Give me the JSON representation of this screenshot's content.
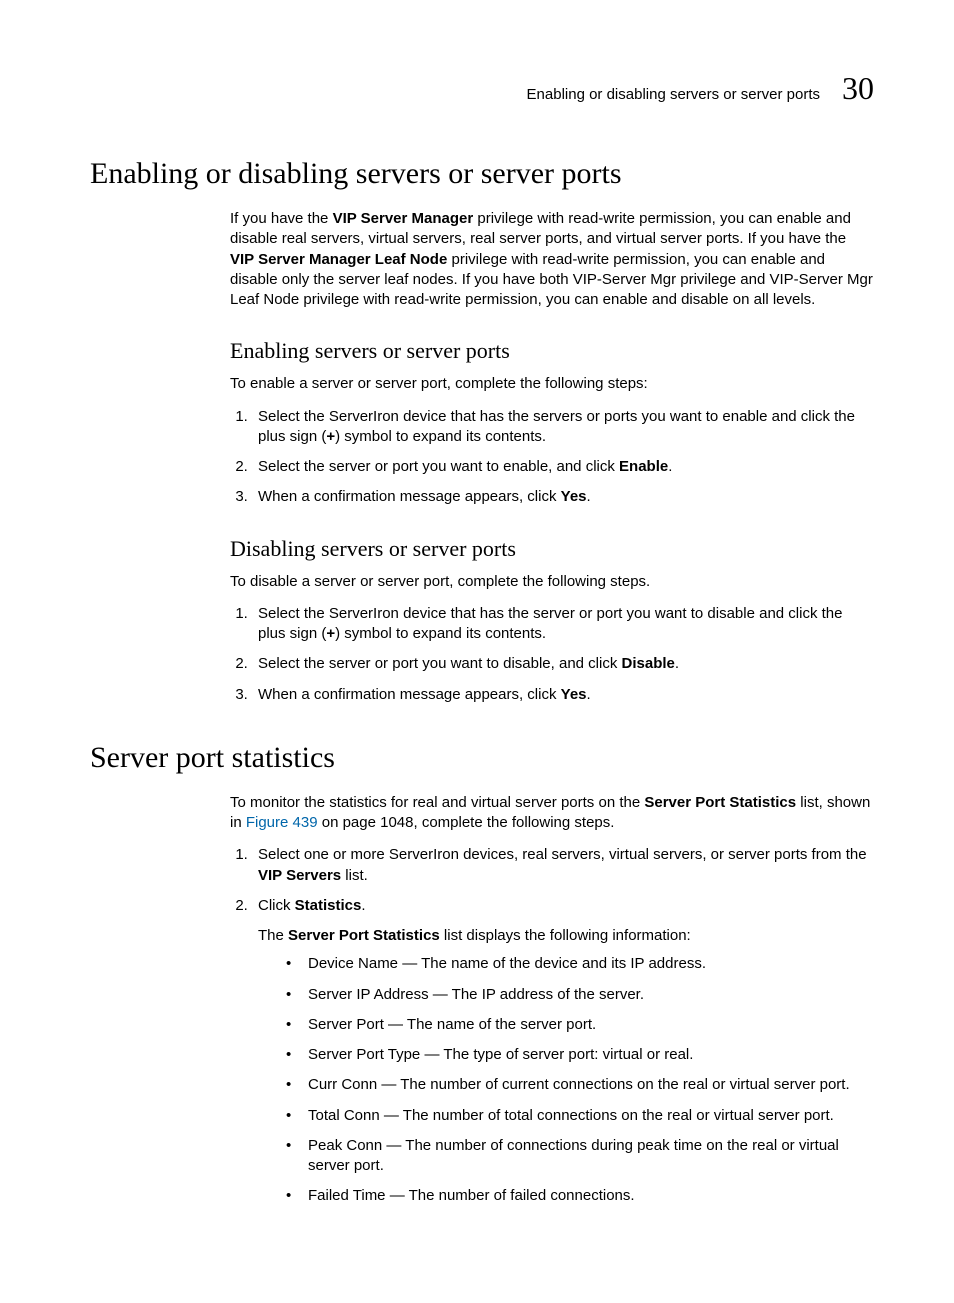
{
  "header": {
    "title": "Enabling or disabling servers or server ports",
    "chapter_num": "30"
  },
  "h1_enable": "Enabling or disabling servers or server ports",
  "intro": {
    "t1": "If you have the ",
    "b1": "VIP Server Manager",
    "t2": " privilege with read-write permission, you can enable and disable real servers, virtual servers, real server ports, and virtual server ports. If you have the ",
    "b2": "VIP Server Manager Leaf Node",
    "t3": " privilege with read-write permission, you can enable and disable only the server leaf nodes. If you have both VIP-Server Mgr privilege and VIP-Server Mgr Leaf Node privilege with read-write permission, you can enable and disable on all levels."
  },
  "h2_enable": "Enabling servers or server ports",
  "enable_intro": "To enable a server or server port, complete the following steps:",
  "enable_steps": {
    "s1a": "Select the ServerIron device that has the servers or ports you want to enable and click the plus sign (",
    "s1b": "+",
    "s1c": ") symbol to expand its contents.",
    "s2a": "Select the server or port you want to enable, and click ",
    "s2b": "Enable",
    "s2c": ".",
    "s3a": "When a confirmation message appears, click ",
    "s3b": "Yes",
    "s3c": "."
  },
  "h2_disable": "Disabling servers or server ports",
  "disable_intro": "To disable a server or server port, complete the following steps.",
  "disable_steps": {
    "s1a": "Select the ServerIron device that has the server or port you want to disable and click the plus sign (",
    "s1b": "+",
    "s1c": ") symbol to expand its contents.",
    "s2a": "Select the server or port you want to disable, and click ",
    "s2b": "Disable",
    "s2c": ".",
    "s3a": "When a confirmation message appears, click ",
    "s3b": "Yes",
    "s3c": "."
  },
  "h1_stats": "Server port statistics",
  "stats_intro": {
    "t1": "To monitor the statistics for real and virtual server ports on the ",
    "b1": "Server Port Statistics",
    "t2": " list, shown in ",
    "link": "Figure 439",
    "t3": " on page 1048, complete the following steps."
  },
  "stats_steps": {
    "s1a": "Select one or more ServerIron devices, real servers, virtual servers, or server ports from the ",
    "s1b": "VIP Servers",
    "s1c": " list.",
    "s2a": "Click ",
    "s2b": "Statistics",
    "s2c": ".",
    "after_a": "The ",
    "after_b": "Server Port Statistics",
    "after_c": " list displays the following information:"
  },
  "stats_bullets": {
    "b1": "Device Name — The name of the device and its IP address.",
    "b2": "Server IP Address — The IP address of the server.",
    "b3": "Server Port — The name of the server port.",
    "b4": "Server Port Type — The type of server port: virtual or real.",
    "b5": "Curr Conn — The number of current connections on the real or virtual server port.",
    "b6": "Total Conn — The number of total connections on the real or virtual server port.",
    "b7": "Peak Conn — The number of connections during peak time on the real or virtual server port.",
    "b8": "Failed Time — The number of failed connections."
  }
}
